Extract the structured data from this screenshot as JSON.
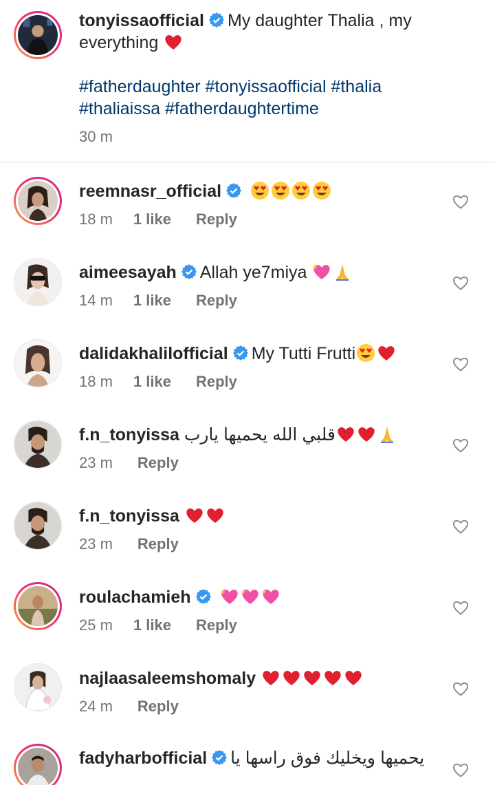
{
  "caption": {
    "username": "tonyissaofficial",
    "text": "My daughter Thalia , my",
    "text_line2": "everything",
    "hashtags_line1": "#fatherdaughter #tonyissaofficial #thalia",
    "hashtags_line2": "#thaliaissa #fatherdaughtertime",
    "time": "30 m"
  },
  "comments": [
    {
      "username": "reemnasr_official",
      "verified": true,
      "text": "",
      "time": "18 m",
      "likes": "1 like",
      "reply": "Reply"
    },
    {
      "username": "aimeesayah",
      "verified": true,
      "text": "Allah ye7miya",
      "time": "14 m",
      "likes": "1 like",
      "reply": "Reply"
    },
    {
      "username": "dalidakhalilofficial",
      "verified": true,
      "text": "My Tutti Frutti",
      "time": "18 m",
      "likes": "1 like",
      "reply": "Reply"
    },
    {
      "username": "f.n_tonyissa",
      "verified": false,
      "text": "قلبي الله يحميها يارب",
      "time": "23 m",
      "likes": "",
      "reply": "Reply"
    },
    {
      "username": "f.n_tonyissa",
      "verified": false,
      "text": "",
      "time": "23 m",
      "likes": "",
      "reply": "Reply"
    },
    {
      "username": "roulachamieh",
      "verified": true,
      "text": "",
      "time": "25 m",
      "likes": "1 like",
      "reply": "Reply"
    },
    {
      "username": "najlaasaleemshomaly",
      "verified": false,
      "text": "",
      "time": "24 m",
      "likes": "",
      "reply": "Reply"
    },
    {
      "username": "fadyharbofficial",
      "verified": true,
      "text": "يحميها ويخليك فوق راسها يا",
      "time": "",
      "likes": "",
      "reply": ""
    }
  ],
  "colors": {
    "verified": "#3897f0",
    "heart": "#ed4956",
    "hashtag": "#00376b",
    "muted": "#737373"
  }
}
